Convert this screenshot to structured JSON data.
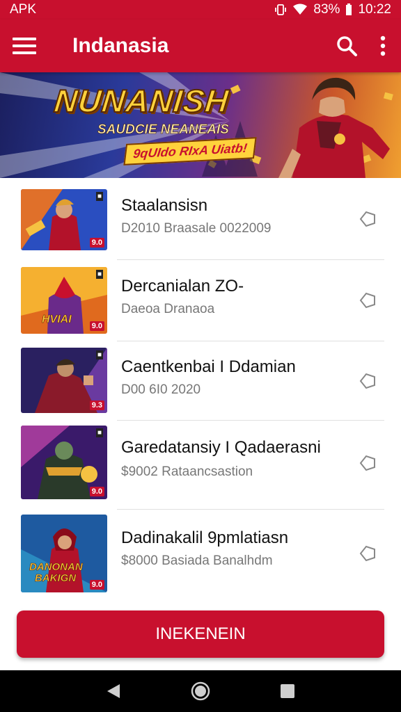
{
  "status_bar": {
    "left_text": "APK",
    "battery_text": "83%",
    "time": "10:22"
  },
  "app_bar": {
    "title": "Indanasia",
    "icons": [
      "menu-icon",
      "search-icon",
      "more-vertical-icon"
    ]
  },
  "banner": {
    "title": "NUNANISH",
    "subtitle": "SAUDCIE NEANEAIS",
    "tagline": "9qUIdo RIxA Uiatb!"
  },
  "items": [
    {
      "title": "Staalansisn",
      "subtitle": "D2010 Braasale 0022009",
      "badge": "9.0",
      "chevron_icon": "chevron-right-outline-icon"
    },
    {
      "title": "Dercanialan ZO-",
      "subtitle": "Daeoa Dranaoa",
      "badge": "9.0",
      "chevron_icon": "chevron-right-outline-icon"
    },
    {
      "title": "Caentkenbai I Ddamian",
      "subtitle": "D00 6I0 2020",
      "badge": "9.3",
      "chevron_icon": "chevron-right-outline-icon"
    },
    {
      "title": "Garedatansiy I Qadaerasni",
      "subtitle": "$9002 Rataancsastion",
      "badge": "9.0",
      "chevron_icon": "chevron-right-outline-icon"
    },
    {
      "title": "Dadinakalil 9pmlatiasn",
      "subtitle": "$8000 Basiada Banalhdm",
      "badge": "9.0",
      "chevron_icon": "chevron-right-outline-icon"
    }
  ],
  "cta": {
    "label": "INEKENEIN"
  },
  "nav": {
    "icons": [
      "back-icon",
      "home-icon",
      "recents-icon"
    ]
  },
  "colors": {
    "primary": "#c8102e",
    "nav": "#000000"
  }
}
